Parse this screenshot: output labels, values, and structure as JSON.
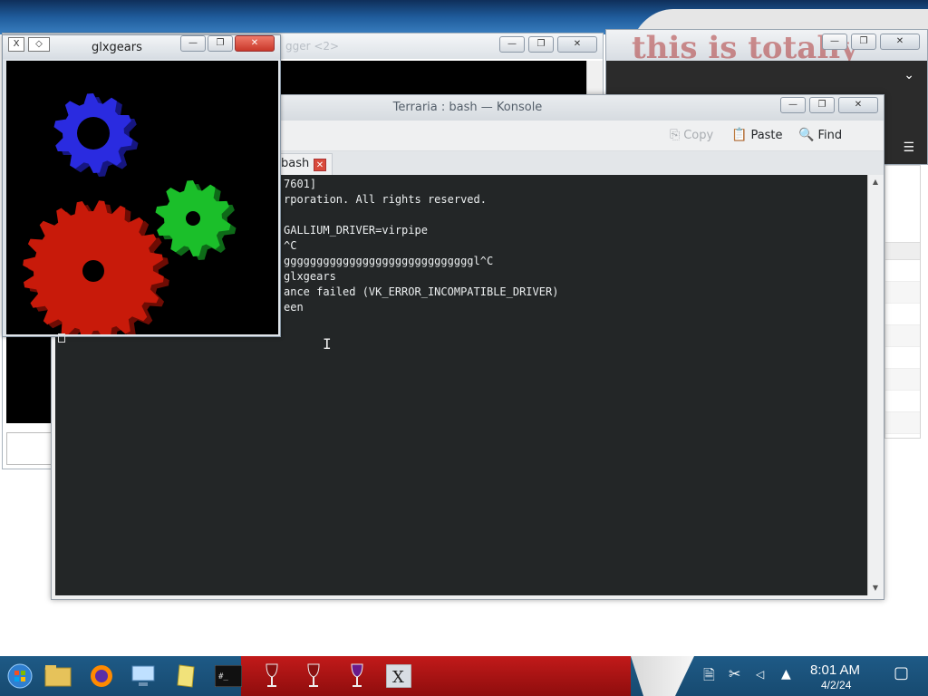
{
  "browser": {
    "graffiti_text": "this is totally"
  },
  "debugger": {
    "title": "gger <2>"
  },
  "konsole": {
    "title": "Terraria : bash — Konsole",
    "toolbar": {
      "copy_label": "Copy",
      "paste_label": "Paste",
      "find_label": "Find"
    },
    "tab_label": "bash",
    "terminal_lines": [
      "7601]",
      "rporation. All rights reserved.",
      "",
      "GALLIUM_DRIVER=virpipe",
      "^C",
      "gggggggggggggggggggggggggggggl^C",
      "glxgears",
      "ance failed (VK_ERROR_INCOMPATIBLE_DRIVER)",
      "een"
    ]
  },
  "glxgears": {
    "title": "glxgears",
    "gears": [
      {
        "name": "blue",
        "color": "#2a2be0"
      },
      {
        "name": "red",
        "color": "#c81a0a"
      },
      {
        "name": "green",
        "color": "#1bbf2a"
      }
    ]
  },
  "taskbar": {
    "time": "8:01 AM",
    "date": "4/2/24",
    "items": [
      "start-orb",
      "file-explorer",
      "firefox",
      "network-computer",
      "notes",
      "terminal",
      "wine-glass-1",
      "wine-glass-2",
      "wine-glass-3",
      "x-server"
    ]
  },
  "colors": {
    "terminal_bg": "#232627",
    "terminal_fg": "#eceff0",
    "taskbar_red": "#c21a1a",
    "accent_blue": "#2b79c2"
  }
}
